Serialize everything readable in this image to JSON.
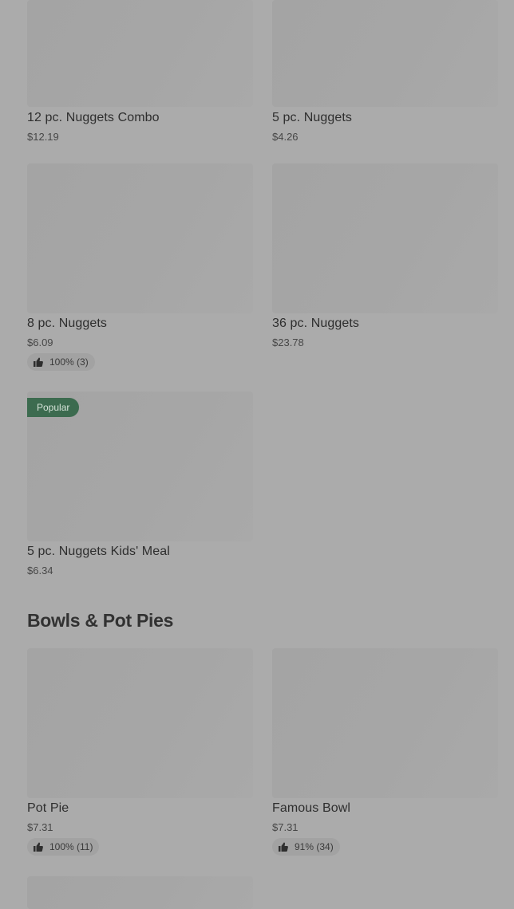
{
  "colors": {
    "background": "#ababab",
    "badge": "#3c6b4f",
    "image_placeholder": "#a6a6a6"
  },
  "items": [
    {
      "name": "12 pc. Nuggets Combo",
      "price": "$12.19"
    },
    {
      "name": "5 pc. Nuggets",
      "price": "$4.26"
    },
    {
      "name": "8 pc. Nuggets",
      "price": "$6.09",
      "rating": "100% (3)",
      "rating_icon": "thumbs-up-icon"
    },
    {
      "name": "36 pc. Nuggets",
      "price": "$23.78"
    },
    {
      "name": "5 pc. Nuggets Kids' Meal",
      "price": "$6.34",
      "badge": "Popular"
    }
  ],
  "section": {
    "title": "Bowls & Pot Pies"
  },
  "bowls": [
    {
      "name": "Pot Pie",
      "price": "$7.31",
      "rating": "100% (11)",
      "rating_icon": "thumbs-up-icon"
    },
    {
      "name": "Famous Bowl",
      "price": "$7.31",
      "rating": "91% (34)",
      "rating_icon": "thumbs-up-icon"
    }
  ]
}
